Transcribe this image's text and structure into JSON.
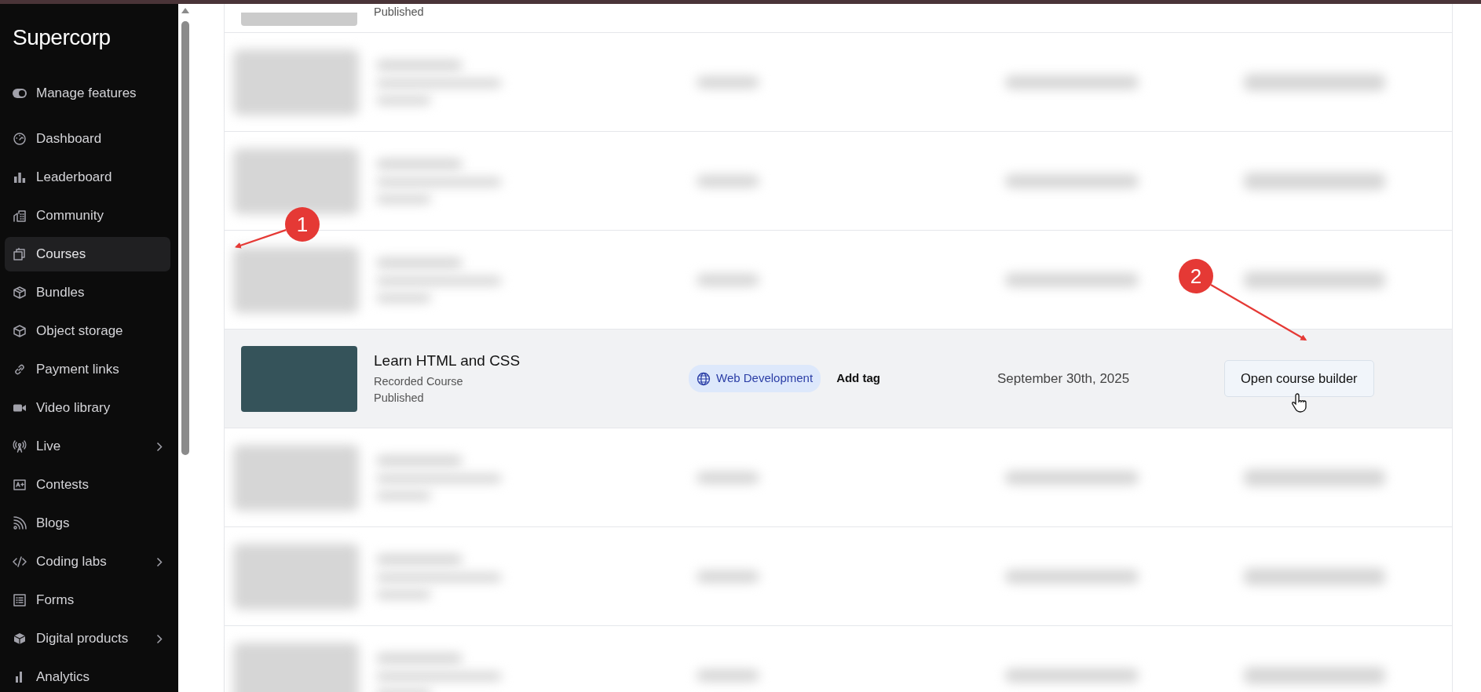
{
  "sidebar": {
    "logo": "Supercorp",
    "manage": {
      "label": "Manage features",
      "on": true
    },
    "items": [
      {
        "label": "Dashboard",
        "selected": false,
        "expandable": false
      },
      {
        "label": "Leaderboard",
        "selected": false,
        "expandable": false
      },
      {
        "label": "Community",
        "selected": false,
        "expandable": false
      },
      {
        "label": "Courses",
        "selected": true,
        "expandable": false
      },
      {
        "label": "Bundles",
        "selected": false,
        "expandable": false
      },
      {
        "label": "Object storage",
        "selected": false,
        "expandable": false
      },
      {
        "label": "Payment links",
        "selected": false,
        "expandable": false
      },
      {
        "label": "Video library",
        "selected": false,
        "expandable": false
      },
      {
        "label": "Live",
        "selected": false,
        "expandable": true
      },
      {
        "label": "Contests",
        "selected": false,
        "expandable": false
      },
      {
        "label": "Blogs",
        "selected": false,
        "expandable": false
      },
      {
        "label": "Coding labs",
        "selected": false,
        "expandable": true
      },
      {
        "label": "Forms",
        "selected": false,
        "expandable": false
      },
      {
        "label": "Digital products",
        "selected": false,
        "expandable": true
      },
      {
        "label": "Analytics",
        "selected": false,
        "expandable": false
      }
    ]
  },
  "rows": [
    {
      "kind": "cut",
      "status": "Published"
    },
    {
      "kind": "blurred"
    },
    {
      "kind": "blurred"
    },
    {
      "kind": "blurred"
    },
    {
      "kind": "course",
      "highlighted": true,
      "title": "Learn HTML and CSS",
      "type": "Recorded Course",
      "status": "Published",
      "tag": "Web Development",
      "add_tag": "Add tag",
      "date": "September 30th, 2025",
      "action": "Open course builder"
    },
    {
      "kind": "blurred"
    },
    {
      "kind": "blurred"
    },
    {
      "kind": "blurred"
    }
  ],
  "annotations": [
    {
      "label": "1"
    },
    {
      "label": "2"
    }
  ]
}
